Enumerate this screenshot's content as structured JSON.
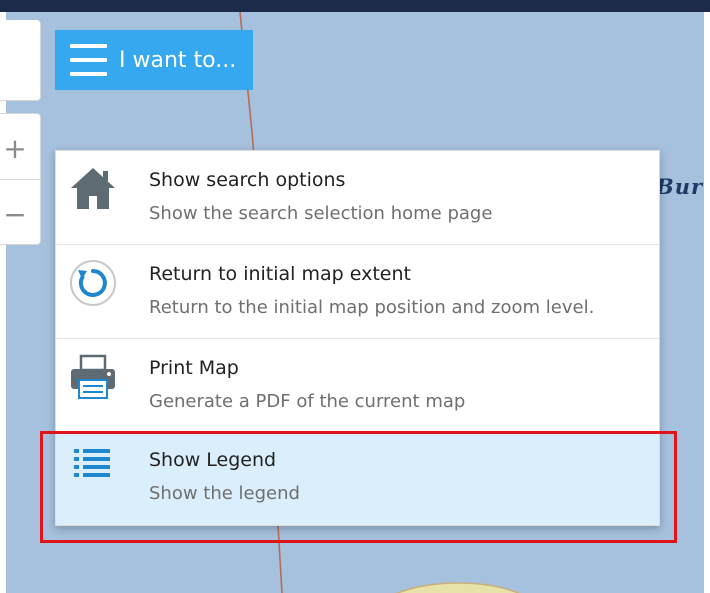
{
  "toolbar": {
    "iwant_label": "I want to..."
  },
  "zoom": {
    "in_label": "+",
    "out_label": "−"
  },
  "map": {
    "place_label": "Burra"
  },
  "menu": {
    "items": [
      {
        "title": "Show search options",
        "description": "Show the search selection home page",
        "icon": "home-icon"
      },
      {
        "title": "Return to initial map extent",
        "description": "Return to the initial map position and zoom level.",
        "icon": "refresh-icon"
      },
      {
        "title": "Print Map",
        "description": "Generate a PDF of the current map",
        "icon": "printer-icon"
      },
      {
        "title": "Show Legend",
        "description": "Show the legend",
        "icon": "list-icon",
        "selected": true
      }
    ]
  },
  "colors": {
    "accent": "#35a8f0",
    "map_water": "#a6c1dd",
    "selected_row": "#dbeefb",
    "highlight": "#e0141b",
    "icon_gray": "#5f6b73",
    "icon_blue": "#1f87d0"
  }
}
